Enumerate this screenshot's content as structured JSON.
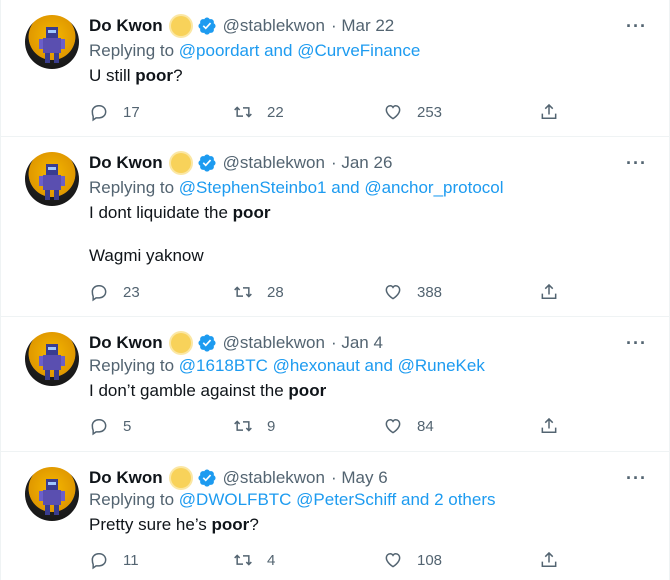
{
  "tweets": [
    {
      "name": "Do Kwon",
      "handle": "@stablekwon",
      "date": "· Mar 22",
      "replying_prefix": "Replying to",
      "replying_parts": [
        "@poordart",
        " and ",
        "@CurveFinance"
      ],
      "lines": [
        [
          "U still ",
          "poor",
          "?"
        ]
      ],
      "replies": "17",
      "retweets": "22",
      "likes": "253"
    },
    {
      "name": "Do Kwon",
      "handle": "@stablekwon",
      "date": "· Jan 26",
      "replying_prefix": "Replying to",
      "replying_parts": [
        "@StephenSteinbo1",
        " and ",
        "@anchor_protocol"
      ],
      "lines": [
        [
          "I dont liquidate the ",
          "poor",
          ""
        ],
        [
          "Wagmi yaknow",
          "",
          ""
        ]
      ],
      "replies": "23",
      "retweets": "28",
      "likes": "388"
    },
    {
      "name": "Do Kwon",
      "handle": "@stablekwon",
      "date": "· Jan 4",
      "replying_prefix": "Replying to",
      "replying_parts": [
        "@1618BTC @hexonaut",
        " and ",
        "@RuneKek"
      ],
      "lines": [
        [
          "I don’t gamble against the ",
          "poor",
          ""
        ]
      ],
      "replies": "5",
      "retweets": "9",
      "likes": "84"
    },
    {
      "name": "Do Kwon",
      "handle": "@stablekwon",
      "date": "· May 6",
      "replying_prefix": "Replying to",
      "replying_parts": [
        "@DWOLFBTC @PeterSchiff",
        " and ",
        "2 others"
      ],
      "lines": [
        [
          "Pretty sure he’s ",
          "poor",
          "?"
        ]
      ],
      "replies": "11",
      "retweets": "4",
      "likes": "108"
    }
  ],
  "icons": {
    "reply": "reply-icon",
    "retweet": "retweet-icon",
    "like": "heart-icon",
    "share": "share-icon",
    "more": "more-icon",
    "verified": "verified-badge-icon",
    "emoji": "sun-emoji-icon"
  },
  "colors": {
    "link": "#1d9bf0",
    "muted": "#536471",
    "text": "#0f1419",
    "verified": "#1d9bf0"
  }
}
